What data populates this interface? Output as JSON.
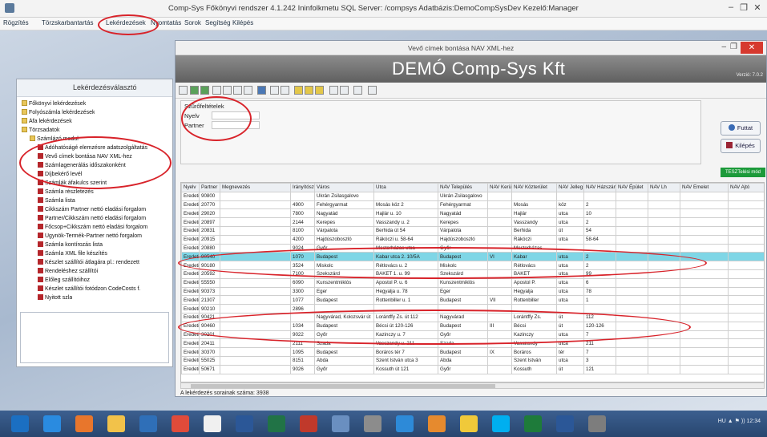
{
  "app": {
    "title": "Comp-Sys Főkönyvi rendszer 4.1.242 Ininfolkmetu SQL Server: /compsys Adatbázis:DemoCompSysDev Kezelő:Manager",
    "minimize": "–",
    "maximize": "❐",
    "close": "✕"
  },
  "menu": [
    "Rögzítés",
    "Törzskarbantartás",
    "Lekérdezések",
    "Nyomtatás",
    "Sorok",
    "Segítség",
    "Kilépés"
  ],
  "explorer": {
    "title": "Lekérdezésválasztó",
    "tree": [
      {
        "label": "Főkönyvi lekérdezések",
        "level": 0,
        "type": "folder"
      },
      {
        "label": "Folyószámla lekérdezések",
        "level": 0,
        "type": "folder"
      },
      {
        "label": "Áfa lekérdezések",
        "level": 0,
        "type": "folder"
      },
      {
        "label": "Törzsadatok",
        "level": 0,
        "type": "folder"
      },
      {
        "label": "Számlázó modul",
        "level": 1,
        "type": "folder"
      },
      {
        "label": "Adóhatóságé elemzésre adatszolgáltatás",
        "level": 2,
        "type": "report"
      },
      {
        "label": "Vevő címek bontása NAV XML-hez",
        "level": 2,
        "type": "report"
      },
      {
        "label": "Számlagenerálás időszakonként",
        "level": 2,
        "type": "report"
      },
      {
        "label": "Díjbekérő levél",
        "level": 2,
        "type": "report"
      },
      {
        "label": "Számlák áfakulcs szerint",
        "level": 2,
        "type": "report"
      },
      {
        "label": "Számla részletezés",
        "level": 2,
        "type": "report"
      },
      {
        "label": "Számla lista",
        "level": 2,
        "type": "report"
      },
      {
        "label": "Cikkszám Partner nettó eladási forgalom",
        "level": 2,
        "type": "report"
      },
      {
        "label": "Partner/Cikkszám nettó eladási forgalom",
        "level": 2,
        "type": "report"
      },
      {
        "label": "Főcsop+Cikkszám nettó eladási forgalom",
        "level": 2,
        "type": "report"
      },
      {
        "label": "Ügynök-Termék-Partner nettó forgalom",
        "level": 2,
        "type": "report"
      },
      {
        "label": "Számla kontírozás lista",
        "level": 2,
        "type": "report"
      },
      {
        "label": "Számla XML file készítés",
        "level": 2,
        "type": "report"
      },
      {
        "label": "Készlet szállítói átlagára pl.: rendezett",
        "level": 2,
        "type": "report"
      },
      {
        "label": "Rendeléshez szállítói",
        "level": 2,
        "type": "report"
      },
      {
        "label": "Előleg szállítóihoz",
        "level": 2,
        "type": "report"
      },
      {
        "label": "Készlet szállítói fotódzon CodeCosts f.",
        "level": 2,
        "type": "report"
      },
      {
        "label": "Nyitott szla",
        "level": 2,
        "type": "report"
      }
    ]
  },
  "report": {
    "title": "Vevő címek bontása NAV XML-hez",
    "company": "DEMÓ Comp-Sys Kft",
    "company_sub": "Verzió: 7.0.2",
    "filter": {
      "heading": "Szűrőfeltételek",
      "labels": [
        "Nyelv",
        "Partner"
      ]
    },
    "buttons": {
      "run": "Futtat",
      "exit": "Kilépés"
    },
    "badge": "TESZTelési mód",
    "status": "A lekérdezés sorainak száma: 3938",
    "columns": [
      "Nyelv",
      "Partner",
      "Megnevezés",
      "Irányítószám",
      "Város",
      "Utca",
      "NAV Település",
      "NAV Kerület",
      "NAV Közterület",
      "NAV Jelleg",
      "NAV Házszám",
      "NAV Épület",
      "NAV Lh",
      "NAV Emelet",
      "NAV Ajtó"
    ],
    "rows": [
      [
        "Eredeti",
        "90800",
        "",
        "",
        "Ukrán Zsilasgalovo",
        "",
        "Ukrán Zsilasgalovo",
        "",
        "",
        "",
        "",
        "",
        "",
        "",
        ""
      ],
      [
        "Eredeti",
        "20770",
        "",
        "4900",
        "Fehérgyarmat",
        "Mosás köz 2",
        "Fehérgyarmat",
        "",
        "Mosás",
        "köz",
        "2",
        "",
        "",
        "",
        ""
      ],
      [
        "Eredeti",
        "29020",
        "",
        "7800",
        "Nagyatád",
        "Hajlár u. 10",
        "Nagyatád",
        "",
        "Hajlár",
        "utca",
        "10",
        "",
        "",
        "",
        ""
      ],
      [
        "Eredeti",
        "20897",
        "",
        "2144",
        "Kerepes",
        "Vasszandy u. 2",
        "Kerepes",
        "",
        "Vasszandy",
        "utca",
        "2",
        "",
        "",
        "",
        ""
      ],
      [
        "Eredeti",
        "20831",
        "",
        "8100",
        "Várpalota",
        "Berhida út 54",
        "Várpalota",
        "",
        "Berhida",
        "út",
        "54",
        "",
        "",
        "",
        ""
      ],
      [
        "Eredeti",
        "20915",
        "",
        "4200",
        "Hajdúszoboszló",
        "Rákóczi u. 58-64",
        "Hajdúszoboszló",
        "",
        "Rákóczi",
        "utca",
        "58-64",
        "",
        "",
        "",
        ""
      ],
      [
        "Eredeti",
        "20880",
        "",
        "9024",
        "Győr",
        "Mesterházas utca",
        "Győr",
        "",
        "Mesterházas",
        "",
        "",
        "",
        "",
        "",
        ""
      ],
      [
        "Eredeti",
        "90540",
        "",
        "1070",
        "Budapest",
        "Kabar utca 2. 10/5A",
        "Budapest",
        "VI",
        "Kabar",
        "utca",
        "2",
        "",
        "",
        "",
        ""
      ],
      [
        "Eredeti",
        "90180",
        "",
        "3524",
        "Miskolc",
        "Rétlovács u. 2",
        "Miskolc",
        "",
        "Rétlovács",
        "utca",
        "2",
        "",
        "",
        "",
        ""
      ],
      [
        "Eredeti",
        "20592",
        "",
        "7100",
        "Szekszárd",
        "BAKET 1. u. 99",
        "Szekszárd",
        "",
        "BAKET",
        "utca",
        "99",
        "",
        "",
        "",
        ""
      ],
      [
        "Eredeti",
        "55550",
        "",
        "6090",
        "Kunszentmiklós",
        "Apostol P. u. 6",
        "Kunszentmiklós",
        "",
        "Apostol P.",
        "utca",
        "6",
        "",
        "",
        "",
        ""
      ],
      [
        "Eredeti",
        "90373",
        "",
        "3300",
        "Eger",
        "Hegyalja u. 78",
        "Eger",
        "",
        "Hegyalja",
        "utca",
        "78",
        "",
        "",
        "",
        ""
      ],
      [
        "Eredeti",
        "21307",
        "",
        "1077",
        "Budapest",
        "Rottenbiller u. 1",
        "Budapest",
        "VII",
        "Rottenbiller",
        "utca",
        "1",
        "",
        "",
        "",
        ""
      ],
      [
        "Eredeti",
        "90210",
        "",
        "2896",
        "",
        "",
        "",
        "",
        "",
        "",
        "",
        "",
        "",
        "",
        ""
      ],
      [
        "Eredeti",
        "90421",
        "",
        "",
        "Nagyvárad, Kolozsvár út",
        "Lorántffy Zs. út 112",
        "Nagyvárad",
        "",
        "Lorántffy Zs.",
        "út",
        "112",
        "",
        "",
        "",
        ""
      ],
      [
        "Eredeti",
        "90460",
        "",
        "1034",
        "Budapest",
        "Bécsi út 120-126",
        "Budapest",
        "III",
        "Bécsi",
        "út",
        "120-126",
        "",
        "",
        "",
        ""
      ],
      [
        "Eredeti",
        "30201",
        "",
        "9022",
        "Győr",
        "Kazinczy u. 7",
        "Győr",
        "",
        "Kazinczy",
        "utca",
        "7",
        "",
        "",
        "",
        ""
      ],
      [
        "Eredeti",
        "20411",
        "",
        "2111",
        "Szada",
        "Vasszandy u. 211",
        "Szada",
        "",
        "Vasszandy",
        "utca",
        "211",
        "",
        "",
        "",
        ""
      ],
      [
        "Eredeti",
        "30370",
        "",
        "1095",
        "Budapest",
        "Boráros tér 7",
        "Budapest",
        "IX",
        "Boráros",
        "tér",
        "7",
        "",
        "",
        "",
        ""
      ],
      [
        "Eredeti",
        "55025",
        "",
        "8151",
        "Abda",
        "Szent István utca 3",
        "Abda",
        "",
        "Szent István",
        "utca",
        "3",
        "",
        "",
        "",
        ""
      ],
      [
        "Eredeti",
        "50671",
        "",
        "9026",
        "Győr",
        "Kossuth út 121",
        "Győr",
        "",
        "Kossuth",
        "út",
        "121",
        "",
        "",
        "",
        ""
      ]
    ],
    "selected_row": 7
  },
  "taskbar": {
    "items": [
      "windows-start",
      "ie",
      "firefox",
      "file-explorer",
      "outlook",
      "chrome",
      "paint",
      "word",
      "excel",
      "acrobat",
      "compsys",
      "calculator",
      "mail",
      "photos",
      "notes",
      "skype",
      "sharepoint",
      "word2",
      "settings"
    ],
    "tray": "HU  ▲  ⚑  ))  12:34"
  }
}
